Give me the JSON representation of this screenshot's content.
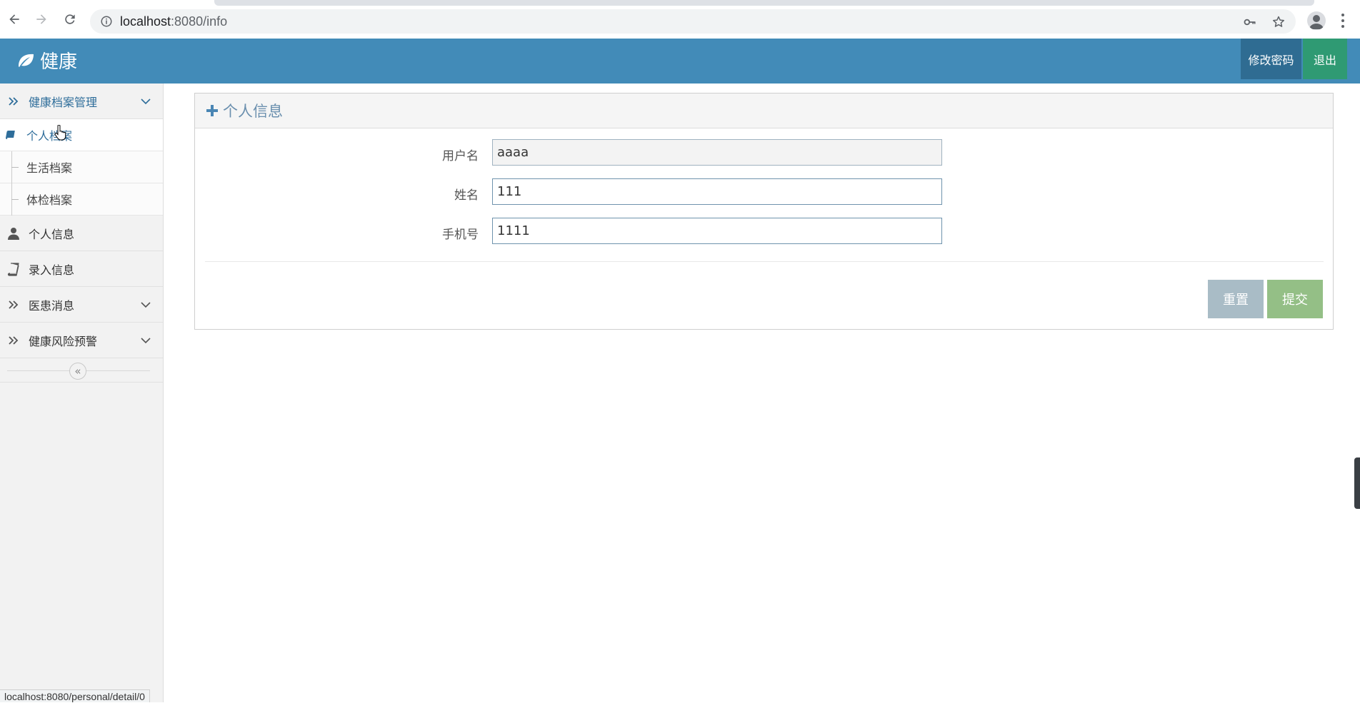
{
  "browser": {
    "url_host": "localhost",
    "url_rest": ":8080/info",
    "icons": [
      "back-arrow-icon",
      "forward-arrow-icon",
      "reload-icon",
      "info-icon",
      "key-icon",
      "star-icon",
      "profile-icon",
      "menu-dots-icon"
    ]
  },
  "header": {
    "brand": "健康",
    "change_password": "修改密码",
    "logout": "退出",
    "colors": {
      "bar": "#428bb8",
      "change_password_bg": "#2f6c92",
      "logout_bg": "#2f9a73"
    }
  },
  "sidebar": {
    "groups": [
      {
        "label": "健康档案管理",
        "icon": "double-chevron-right-icon",
        "expanded": true,
        "items": [
          {
            "label": "个人档案"
          },
          {
            "label": "生活档案"
          },
          {
            "label": "体检档案"
          }
        ]
      },
      {
        "label": "个人信息",
        "icon": "user-icon"
      },
      {
        "label": "录入信息",
        "icon": "book-icon"
      },
      {
        "label": "医患消息",
        "icon": "double-chevron-right-icon"
      },
      {
        "label": "健康风险预警",
        "icon": "double-chevron-right-icon"
      }
    ],
    "collapse_glyph": "«"
  },
  "panel": {
    "title": "个人信息",
    "fields": [
      {
        "label": "用户名",
        "value": "aaaa"
      },
      {
        "label": "姓名",
        "value": "111"
      },
      {
        "label": "手机号",
        "value": "1111"
      }
    ],
    "reset": "重置",
    "submit": "提交"
  },
  "status_bar": "localhost:8080/personal/detail/0"
}
